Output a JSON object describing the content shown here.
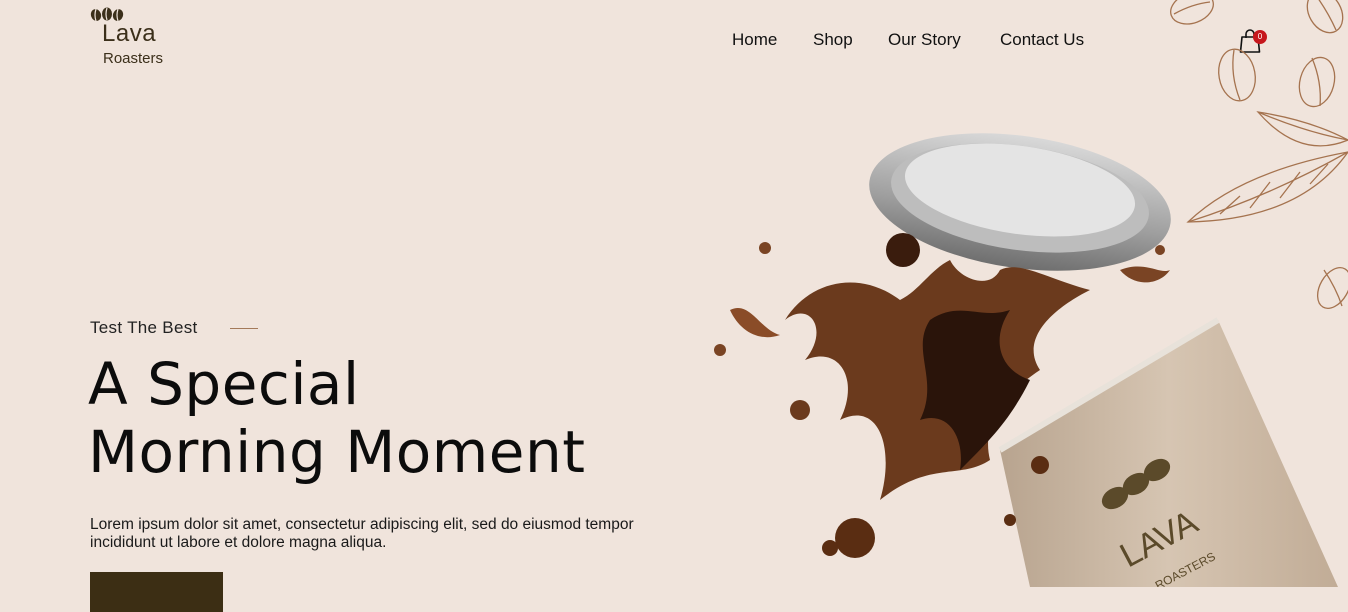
{
  "brand": {
    "name": "Lava",
    "sub": "Roasters",
    "color": "#3b2f1a"
  },
  "nav": {
    "items": [
      "Home",
      "Shop",
      "Our Story",
      "Contact Us"
    ]
  },
  "cart": {
    "count": "0",
    "badge_color": "#c6171d"
  },
  "hero": {
    "tagline": "Test The Best",
    "headline_line1": "A Special",
    "headline_line2": "Morning Moment",
    "description": "Lorem ipsum dolor sit amet, consectetur adipiscing elit, sed do eiusmod tempor incididunt ut labore et dolore magna aliqua.",
    "cta_label": "",
    "cup_brand": "LAVA",
    "cup_sub": "ROASTERS"
  },
  "colors": {
    "background": "#f0e4dc",
    "accent": "#3c2e14",
    "coffee": "#6b3a1d"
  },
  "icons": [
    "coffee-beans-logo-icon",
    "shopping-bag-icon",
    "coffee-splash-illustration",
    "coffee-leaf-bean-drawing"
  ]
}
